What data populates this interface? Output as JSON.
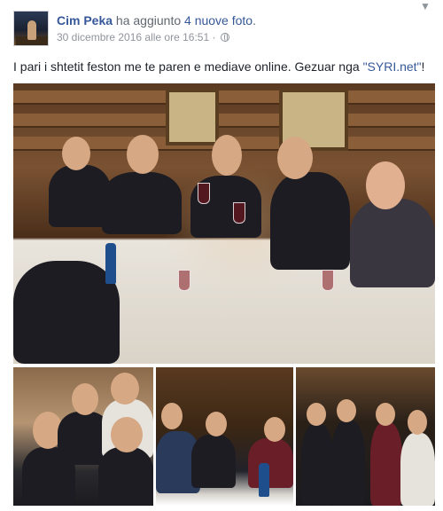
{
  "post": {
    "author": "Cim Peka",
    "action_prefix": " ha aggiunto ",
    "action_link": "4 nuove foto",
    "action_suffix": ".",
    "timestamp": "30 dicembre 2016 alle ore 16:51",
    "separator": " · ",
    "privacy_icon": "globe-icon",
    "menu_icon": "chevron-down-icon",
    "caption_text": "I pari i shtetit feston me te paren e mediave online. Gezuar nga ",
    "caption_link": "\"SYRI.net\"",
    "caption_end": "!"
  },
  "photos": [
    {
      "name": "group-dinner-main-photo"
    },
    {
      "name": "selfie-thumbnail"
    },
    {
      "name": "restaurant-group-thumbnail"
    },
    {
      "name": "standing-group-thumbnail"
    }
  ],
  "colors": {
    "link": "#365899",
    "meta_text": "#90949c",
    "body_text": "#1d2129"
  }
}
